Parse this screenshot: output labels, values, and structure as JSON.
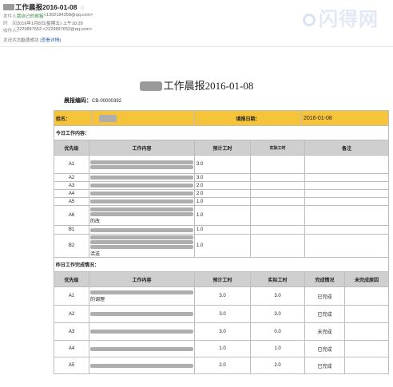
{
  "mail": {
    "subject": "工作晨报2016-01-08",
    "star": "☆",
    "from_label": "发件人：",
    "from_name": "我自己的邮箱",
    "from_addr": "<1302184358@qq.com>",
    "time_label": "时　间：",
    "time_value": "2016年1月8日(星期五) 上午10:29",
    "to_label": "收件人：",
    "to_value": "2229897652 <2229897652@qq.com>",
    "status_label": "发送状态：",
    "status_value": "投递成功",
    "status_link": "[查看详情]"
  },
  "watermark": "闪得网",
  "report": {
    "title": "工作晨报2016-01-08",
    "code_label": "晨报编码：",
    "code_value": "CB-00000392",
    "name_label": "姓名：",
    "date_label": "填报日期：",
    "date_value": "2016-01-08"
  },
  "today": {
    "section_title": "今日工作内容：",
    "headers": [
      "优先级",
      "工作内容",
      "预计工时",
      "实际工时",
      "备注"
    ],
    "rows": [
      {
        "priority": "A1",
        "text": "",
        "est": "3.0"
      },
      {
        "priority": "A2",
        "text": "",
        "est": "3.0"
      },
      {
        "priority": "A3",
        "text": "",
        "est": "2.0"
      },
      {
        "priority": "A4",
        "text": "",
        "est": "2.0"
      },
      {
        "priority": "A5",
        "text": "",
        "est": "1.0"
      },
      {
        "priority": "A6",
        "text": "的改",
        "est": "1.0"
      },
      {
        "priority": "B1",
        "text": "",
        "est": "1.0"
      },
      {
        "priority": "B2",
        "text": "活送",
        "est": "1.0"
      }
    ]
  },
  "yesterday": {
    "section_title": "昨日工作完成情况：",
    "headers": [
      "优先级",
      "工作内容",
      "预计工时",
      "实际工时",
      "完成情况",
      "未完成原因"
    ],
    "rows": [
      {
        "priority": "A1",
        "text": "的调理",
        "est": "3.0",
        "act": "3.0",
        "status": "已完成"
      },
      {
        "priority": "A2",
        "text": "",
        "est": "3.0",
        "act": "3.0",
        "status": "已完成"
      },
      {
        "priority": "A3",
        "text": "",
        "est": "3.0",
        "act": "0.0",
        "status": "未完成"
      },
      {
        "priority": "A4",
        "text": "",
        "est": "1.0",
        "act": "1.0",
        "status": "已完成"
      },
      {
        "priority": "A5",
        "text": "",
        "est": "2.0",
        "act": "2.0",
        "status": "已完成"
      }
    ]
  },
  "colors": {
    "header_yellow": "#f6c43a",
    "header_gray": "#cfcfcf",
    "link_blue": "#2a5ea8",
    "sender_green": "#3a8a3a"
  }
}
